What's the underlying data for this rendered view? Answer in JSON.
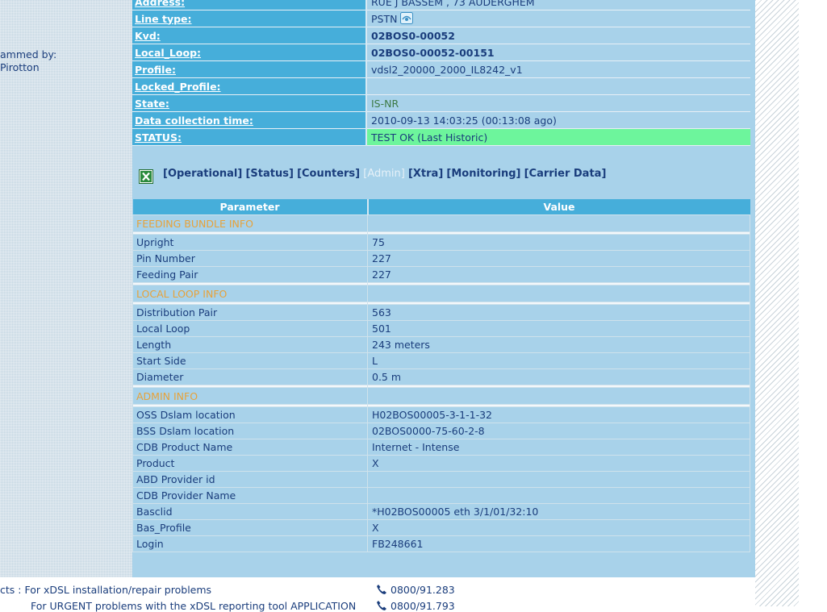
{
  "left_panel": {
    "credit_label": "ammed by:",
    "credit_name": "Pirotton"
  },
  "info_rows": [
    {
      "label": "Address:",
      "value": "RUE J BASSEM , 73 AUDERGHEM"
    },
    {
      "label": "Line type:",
      "value": "PSTN"
    },
    {
      "label": "Kvd:",
      "value": "02BOS0-00052"
    },
    {
      "label": "Local_Loop:",
      "value": "02BOS0-00052-00151"
    },
    {
      "label": "Profile:",
      "value": "vdsl2_20000_2000_IL8242_v1"
    },
    {
      "label": "Locked_Profile:",
      "value": ""
    },
    {
      "label": "State:",
      "value": "IS-NR"
    },
    {
      "label": "Data collection time:",
      "value": "2010-09-13 14:03:25 (00:13:08 ago)"
    },
    {
      "label": "STATUS:",
      "value": "TEST OK (Last Historic)"
    }
  ],
  "icons": {
    "pstn": "phone-line-icon",
    "export": "excel-export-icon",
    "phone": "phone-handset-icon"
  },
  "tabs": [
    {
      "label": "[Operational]",
      "active": false
    },
    {
      "label": "[Status]",
      "active": false
    },
    {
      "label": "[Counters]",
      "active": false
    },
    {
      "label": "[Admin]",
      "active": true
    },
    {
      "label": "[Xtra]",
      "active": false
    },
    {
      "label": "[Monitoring]",
      "active": false
    },
    {
      "label": "[Carrier Data]",
      "active": false
    }
  ],
  "param_table": {
    "header_parameter": "Parameter",
    "header_value": "Value",
    "sections": [
      {
        "title": "FEEDING BUNDLE INFO",
        "rows": [
          {
            "param": "Upright",
            "value": "75"
          },
          {
            "param": "Pin Number",
            "value": "227"
          },
          {
            "param": "Feeding Pair",
            "value": "227"
          }
        ]
      },
      {
        "title": "LOCAL LOOP INFO",
        "rows": [
          {
            "param": "Distribution Pair",
            "value": "563"
          },
          {
            "param": "Local Loop",
            "value": "501"
          },
          {
            "param": "Length",
            "value": "243 meters"
          },
          {
            "param": "Start Side",
            "value": "L"
          },
          {
            "param": "Diameter",
            "value": "0.5 m"
          }
        ]
      },
      {
        "title": "ADMIN INFO",
        "rows": [
          {
            "param": "OSS Dslam location",
            "value": "H02BOS00005-3-1-1-32"
          },
          {
            "param": "BSS Dslam location",
            "value": "02BOS0000-75-60-2-8"
          },
          {
            "param": "CDB Product Name",
            "value": "Internet - Intense"
          },
          {
            "param": "Product",
            "value": "X"
          },
          {
            "param": "ABD Provider id",
            "value": ""
          },
          {
            "param": "CDB Provider Name",
            "value": ""
          },
          {
            "param": "Basclid",
            "value": "*H02BOS00005 eth 3/1/01/32:10"
          },
          {
            "param": "Bas_Profile",
            "value": "X"
          },
          {
            "param": "Login",
            "value": "FB248661"
          }
        ]
      }
    ]
  },
  "contacts": [
    {
      "text": "cts : For xDSL installation/repair problems",
      "phone": "0800/91.283"
    },
    {
      "text": "For URGENT problems with the xDSL reporting tool APPLICATION",
      "phone": "0800/91.793"
    }
  ],
  "colors": {
    "label_bg": "#46aeda",
    "panel_bg": "#a8d2ea",
    "status_ok_bg": "#6df59c",
    "section_title": "#e7a23a",
    "text": "#1a3d7c"
  }
}
